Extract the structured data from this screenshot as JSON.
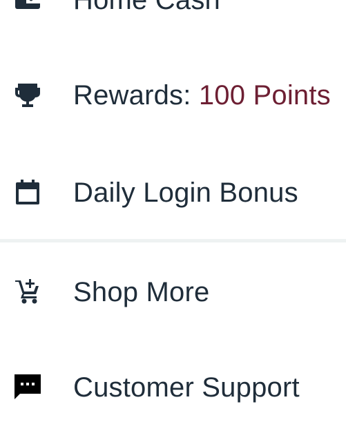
{
  "menu": {
    "items": [
      {
        "id": "home-cash",
        "label": "Home Cash",
        "icon": "wallet-icon"
      },
      {
        "id": "rewards",
        "label": "Rewards: ",
        "value": "100 Points",
        "icon": "trophy-icon"
      },
      {
        "id": "daily-login",
        "label": "Daily Login Bonus",
        "icon": "calendar-icon"
      },
      {
        "id": "shop-more",
        "label": "Shop More",
        "icon": "add-to-cart-icon"
      },
      {
        "id": "customer-support",
        "label": "Customer Support",
        "icon": "chat-bubble-icon"
      }
    ]
  },
  "colors": {
    "text": "#1f2d3a",
    "accent": "#6d1f33",
    "divider": "#eef2f2"
  }
}
